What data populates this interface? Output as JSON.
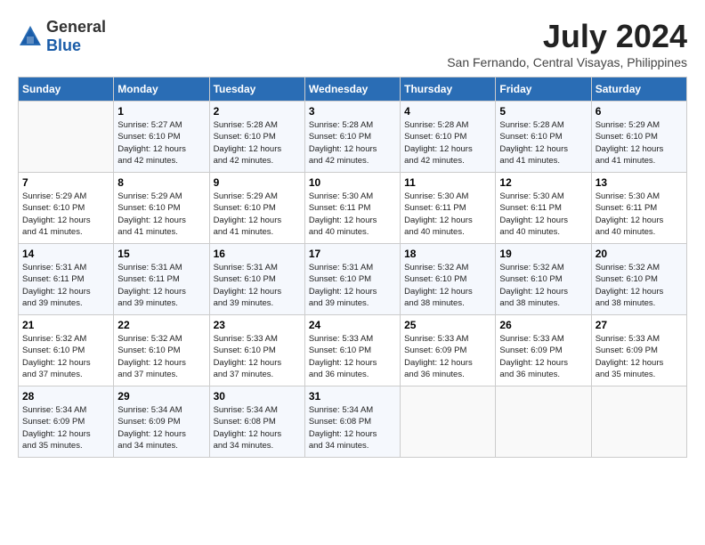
{
  "header": {
    "logo_general": "General",
    "logo_blue": "Blue",
    "month_year": "July 2024",
    "location": "San Fernando, Central Visayas, Philippines"
  },
  "weekdays": [
    "Sunday",
    "Monday",
    "Tuesday",
    "Wednesday",
    "Thursday",
    "Friday",
    "Saturday"
  ],
  "weeks": [
    [
      {
        "day": "",
        "info": ""
      },
      {
        "day": "1",
        "info": "Sunrise: 5:27 AM\nSunset: 6:10 PM\nDaylight: 12 hours\nand 42 minutes."
      },
      {
        "day": "2",
        "info": "Sunrise: 5:28 AM\nSunset: 6:10 PM\nDaylight: 12 hours\nand 42 minutes."
      },
      {
        "day": "3",
        "info": "Sunrise: 5:28 AM\nSunset: 6:10 PM\nDaylight: 12 hours\nand 42 minutes."
      },
      {
        "day": "4",
        "info": "Sunrise: 5:28 AM\nSunset: 6:10 PM\nDaylight: 12 hours\nand 42 minutes."
      },
      {
        "day": "5",
        "info": "Sunrise: 5:28 AM\nSunset: 6:10 PM\nDaylight: 12 hours\nand 41 minutes."
      },
      {
        "day": "6",
        "info": "Sunrise: 5:29 AM\nSunset: 6:10 PM\nDaylight: 12 hours\nand 41 minutes."
      }
    ],
    [
      {
        "day": "7",
        "info": "Sunrise: 5:29 AM\nSunset: 6:10 PM\nDaylight: 12 hours\nand 41 minutes."
      },
      {
        "day": "8",
        "info": "Sunrise: 5:29 AM\nSunset: 6:10 PM\nDaylight: 12 hours\nand 41 minutes."
      },
      {
        "day": "9",
        "info": "Sunrise: 5:29 AM\nSunset: 6:10 PM\nDaylight: 12 hours\nand 41 minutes."
      },
      {
        "day": "10",
        "info": "Sunrise: 5:30 AM\nSunset: 6:11 PM\nDaylight: 12 hours\nand 40 minutes."
      },
      {
        "day": "11",
        "info": "Sunrise: 5:30 AM\nSunset: 6:11 PM\nDaylight: 12 hours\nand 40 minutes."
      },
      {
        "day": "12",
        "info": "Sunrise: 5:30 AM\nSunset: 6:11 PM\nDaylight: 12 hours\nand 40 minutes."
      },
      {
        "day": "13",
        "info": "Sunrise: 5:30 AM\nSunset: 6:11 PM\nDaylight: 12 hours\nand 40 minutes."
      }
    ],
    [
      {
        "day": "14",
        "info": "Sunrise: 5:31 AM\nSunset: 6:11 PM\nDaylight: 12 hours\nand 39 minutes."
      },
      {
        "day": "15",
        "info": "Sunrise: 5:31 AM\nSunset: 6:11 PM\nDaylight: 12 hours\nand 39 minutes."
      },
      {
        "day": "16",
        "info": "Sunrise: 5:31 AM\nSunset: 6:10 PM\nDaylight: 12 hours\nand 39 minutes."
      },
      {
        "day": "17",
        "info": "Sunrise: 5:31 AM\nSunset: 6:10 PM\nDaylight: 12 hours\nand 39 minutes."
      },
      {
        "day": "18",
        "info": "Sunrise: 5:32 AM\nSunset: 6:10 PM\nDaylight: 12 hours\nand 38 minutes."
      },
      {
        "day": "19",
        "info": "Sunrise: 5:32 AM\nSunset: 6:10 PM\nDaylight: 12 hours\nand 38 minutes."
      },
      {
        "day": "20",
        "info": "Sunrise: 5:32 AM\nSunset: 6:10 PM\nDaylight: 12 hours\nand 38 minutes."
      }
    ],
    [
      {
        "day": "21",
        "info": "Sunrise: 5:32 AM\nSunset: 6:10 PM\nDaylight: 12 hours\nand 37 minutes."
      },
      {
        "day": "22",
        "info": "Sunrise: 5:32 AM\nSunset: 6:10 PM\nDaylight: 12 hours\nand 37 minutes."
      },
      {
        "day": "23",
        "info": "Sunrise: 5:33 AM\nSunset: 6:10 PM\nDaylight: 12 hours\nand 37 minutes."
      },
      {
        "day": "24",
        "info": "Sunrise: 5:33 AM\nSunset: 6:10 PM\nDaylight: 12 hours\nand 36 minutes."
      },
      {
        "day": "25",
        "info": "Sunrise: 5:33 AM\nSunset: 6:09 PM\nDaylight: 12 hours\nand 36 minutes."
      },
      {
        "day": "26",
        "info": "Sunrise: 5:33 AM\nSunset: 6:09 PM\nDaylight: 12 hours\nand 36 minutes."
      },
      {
        "day": "27",
        "info": "Sunrise: 5:33 AM\nSunset: 6:09 PM\nDaylight: 12 hours\nand 35 minutes."
      }
    ],
    [
      {
        "day": "28",
        "info": "Sunrise: 5:34 AM\nSunset: 6:09 PM\nDaylight: 12 hours\nand 35 minutes."
      },
      {
        "day": "29",
        "info": "Sunrise: 5:34 AM\nSunset: 6:09 PM\nDaylight: 12 hours\nand 34 minutes."
      },
      {
        "day": "30",
        "info": "Sunrise: 5:34 AM\nSunset: 6:08 PM\nDaylight: 12 hours\nand 34 minutes."
      },
      {
        "day": "31",
        "info": "Sunrise: 5:34 AM\nSunset: 6:08 PM\nDaylight: 12 hours\nand 34 minutes."
      },
      {
        "day": "",
        "info": ""
      },
      {
        "day": "",
        "info": ""
      },
      {
        "day": "",
        "info": ""
      }
    ]
  ]
}
